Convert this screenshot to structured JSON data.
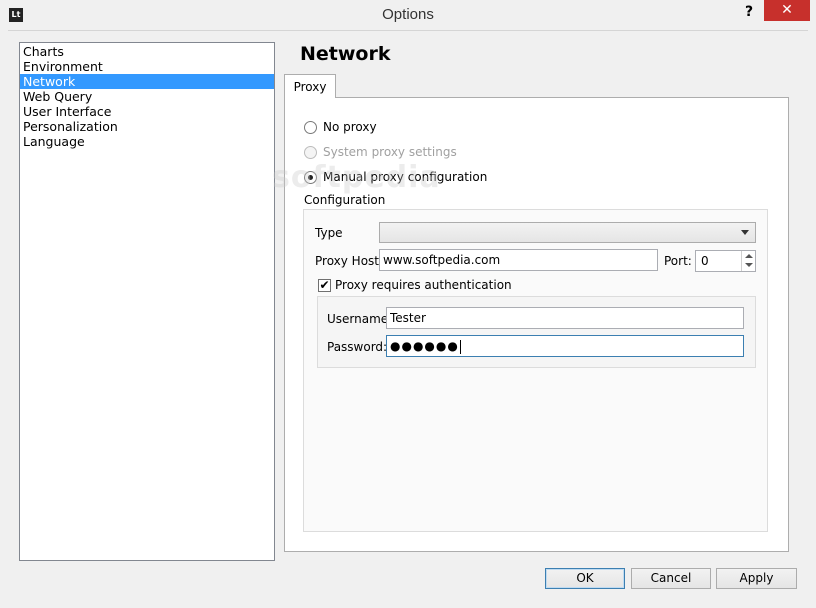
{
  "window": {
    "title": "Options",
    "app_icon_text": "Lt",
    "help_glyph": "?",
    "close_glyph": "✕"
  },
  "sidebar": {
    "items": [
      {
        "label": "Charts"
      },
      {
        "label": "Environment"
      },
      {
        "label": "Network"
      },
      {
        "label": "Web Query"
      },
      {
        "label": "User Interface"
      },
      {
        "label": "Personalization"
      },
      {
        "label": "Language"
      }
    ],
    "selected_index": 2
  },
  "page": {
    "title": "Network",
    "tabs": [
      {
        "label": "Proxy"
      }
    ]
  },
  "proxy": {
    "options": [
      {
        "label": "No proxy",
        "selected": false,
        "enabled": true
      },
      {
        "label": "System proxy settings",
        "selected": false,
        "enabled": false
      },
      {
        "label": "Manual proxy configuration",
        "selected": true,
        "enabled": true
      }
    ],
    "configuration_label": "Configuration",
    "type_label": "Type",
    "type_value": "",
    "host_label": "Proxy Host:",
    "host_value": "www.softpedia.com",
    "port_label": "Port:",
    "port_value": "0",
    "auth_label": "Proxy requires authentication",
    "auth_checked": true,
    "auth_check_glyph": "✔",
    "username_label": "Username:",
    "username_value": "Tester",
    "password_label": "Password:",
    "password_value": "●●●●●●"
  },
  "buttons": {
    "ok": "OK",
    "cancel": "Cancel",
    "apply": "Apply"
  },
  "watermark": "softpedia",
  "colors": {
    "selection": "#3399ff",
    "close_button": "#c7302c"
  }
}
